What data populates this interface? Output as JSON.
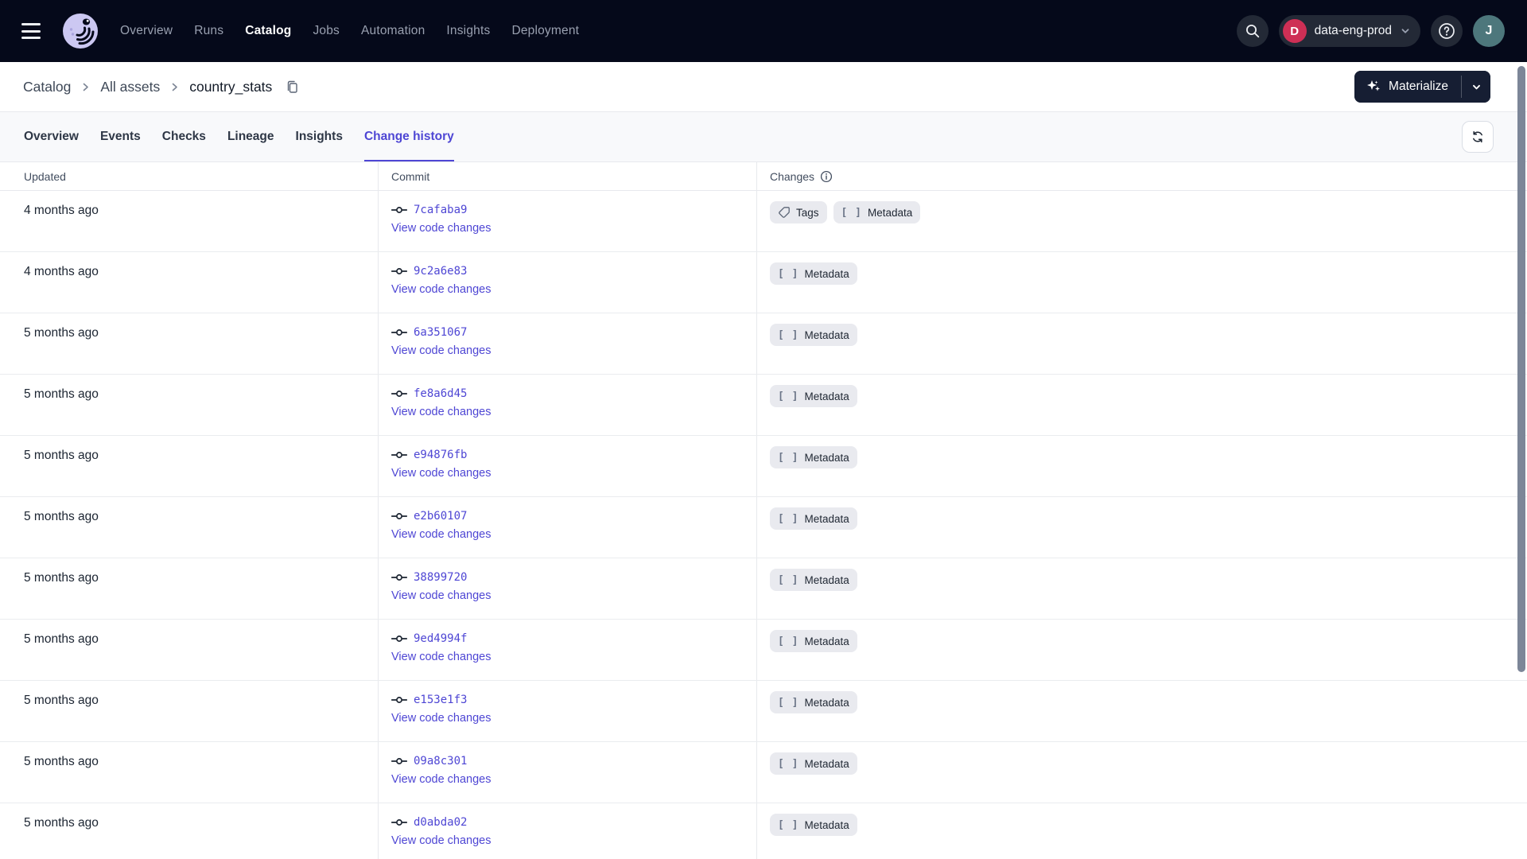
{
  "topnav": {
    "items": [
      {
        "label": "Overview",
        "active": false
      },
      {
        "label": "Runs",
        "active": false
      },
      {
        "label": "Catalog",
        "active": true
      },
      {
        "label": "Jobs",
        "active": false
      },
      {
        "label": "Automation",
        "active": false
      },
      {
        "label": "Insights",
        "active": false
      },
      {
        "label": "Deployment",
        "active": false
      }
    ],
    "deployment": {
      "initial": "D",
      "name": "data-eng-prod"
    },
    "avatar_initial": "J"
  },
  "breadcrumb": {
    "links": [
      "Catalog",
      "All assets"
    ],
    "current": "country_stats"
  },
  "actions": {
    "materialize_label": "Materialize"
  },
  "tabs": [
    {
      "label": "Overview",
      "active": false
    },
    {
      "label": "Events",
      "active": false
    },
    {
      "label": "Checks",
      "active": false
    },
    {
      "label": "Lineage",
      "active": false
    },
    {
      "label": "Insights",
      "active": false
    },
    {
      "label": "Change history",
      "active": true
    }
  ],
  "table": {
    "columns": {
      "updated": "Updated",
      "commit": "Commit",
      "changes": "Changes"
    },
    "view_code_label": "View code changes",
    "rows": [
      {
        "updated": "4 months ago",
        "commit": "7cafaba9",
        "changes": [
          "Tags",
          "Metadata"
        ]
      },
      {
        "updated": "4 months ago",
        "commit": "9c2a6e83",
        "changes": [
          "Metadata"
        ]
      },
      {
        "updated": "5 months ago",
        "commit": "6a351067",
        "changes": [
          "Metadata"
        ]
      },
      {
        "updated": "5 months ago",
        "commit": "fe8a6d45",
        "changes": [
          "Metadata"
        ]
      },
      {
        "updated": "5 months ago",
        "commit": "e94876fb",
        "changes": [
          "Metadata"
        ]
      },
      {
        "updated": "5 months ago",
        "commit": "e2b60107",
        "changes": [
          "Metadata"
        ]
      },
      {
        "updated": "5 months ago",
        "commit": "38899720",
        "changes": [
          "Metadata"
        ]
      },
      {
        "updated": "5 months ago",
        "commit": "9ed4994f",
        "changes": [
          "Metadata"
        ]
      },
      {
        "updated": "5 months ago",
        "commit": "e153e1f3",
        "changes": [
          "Metadata"
        ]
      },
      {
        "updated": "5 months ago",
        "commit": "09a8c301",
        "changes": [
          "Metadata"
        ]
      },
      {
        "updated": "5 months ago",
        "commit": "d0abda02",
        "changes": [
          "Metadata"
        ]
      }
    ]
  },
  "icons": {
    "metadata_glyph": "[ ]"
  },
  "colors": {
    "nav_background": "#05091A",
    "accent_indigo": "#4E46D4",
    "deployment_badge_red": "#CE2F55",
    "avatar_teal": "#4D777C",
    "badge_background": "#E9EAEF",
    "materialize_button": "#161E33"
  }
}
